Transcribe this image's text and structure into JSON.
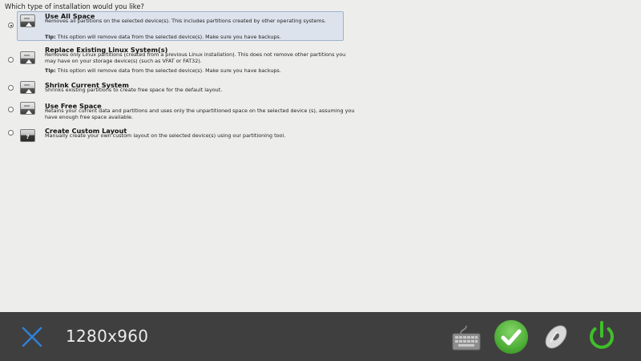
{
  "page": {
    "question": "Which type of installation would you like?"
  },
  "options": [
    {
      "title": "Use All Space",
      "description": "Removes all partitions on the selected device(s).  This includes partitions created by other operating systems.",
      "tip_label": "Tip:",
      "tip": " This option will remove data from the selected device(s).  Make sure you have backups.",
      "selected": true,
      "icon": "disk-icon"
    },
    {
      "title": "Replace Existing Linux System(s)",
      "description": "Removes only Linux partitions (created from a previous Linux installation).  This does not remove other partitions you may have on your storage device(s) (such as VFAT or FAT32).",
      "tip_label": "Tip:",
      "tip": " This option will remove data from the selected device(s).  Make sure you have backups.",
      "selected": false,
      "icon": "disk-icon"
    },
    {
      "title": "Shrink Current System",
      "description": "Shrinks existing partitions to create free space for the default layout.",
      "selected": false,
      "icon": "disk-shrink-icon"
    },
    {
      "title": "Use Free Space",
      "description": "Retains your current data and partitions and uses only the unpartitioned space on the selected device (s), assuming you have enough free space available.",
      "selected": false,
      "icon": "disk-free-icon"
    },
    {
      "title": "Create Custom Layout",
      "description": "Manually create your own custom layout on the selected device(s) using our partitioning tool.",
      "selected": false,
      "icon": "disk-custom-icon",
      "icon_glyph": "?"
    }
  ],
  "toolbar": {
    "resolution": "1280x960",
    "close_icon": "close-icon",
    "keyboard_icon": "keyboard-icon",
    "confirm_icon": "checkmark-icon",
    "disc_icon": "disc-icon",
    "power_icon": "power-icon",
    "colors": {
      "bar": "#403f3f",
      "accent_blue": "#2f7fd8",
      "accent_green": "#3fbf2a"
    }
  }
}
